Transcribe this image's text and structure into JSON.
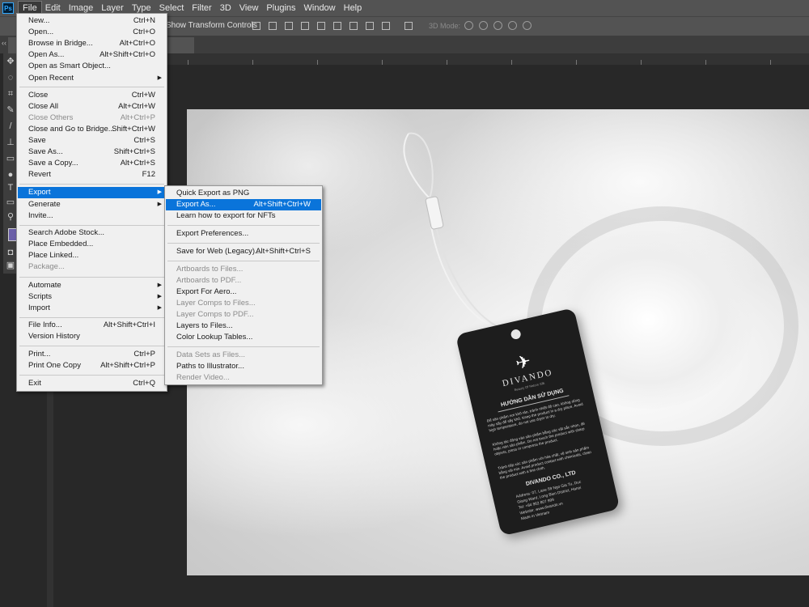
{
  "menubar": {
    "logo": "Ps",
    "items": [
      "File",
      "Edit",
      "Image",
      "Layer",
      "Type",
      "Select",
      "Filter",
      "3D",
      "View",
      "Plugins",
      "Window",
      "Help"
    ]
  },
  "options_bar": {
    "transform_label": "Show Transform Controls",
    "mode_3d": "3D Mode:"
  },
  "toolbar": {
    "collapse": "‹‹"
  },
  "file_menu": {
    "items": [
      {
        "label": "New...",
        "shortcut": "Ctrl+N"
      },
      {
        "label": "Open...",
        "shortcut": "Ctrl+O"
      },
      {
        "label": "Browse in Bridge...",
        "shortcut": "Alt+Ctrl+O"
      },
      {
        "label": "Open As...",
        "shortcut": "Alt+Shift+Ctrl+O"
      },
      {
        "label": "Open as Smart Object..."
      },
      {
        "label": "Open Recent",
        "submenu": true
      },
      {
        "label": "Close",
        "shortcut": "Ctrl+W"
      },
      {
        "label": "Close All",
        "shortcut": "Alt+Ctrl+W"
      },
      {
        "label": "Close Others",
        "shortcut": "Alt+Ctrl+P",
        "disabled": true
      },
      {
        "label": "Close and Go to Bridge...",
        "shortcut": "Shift+Ctrl+W"
      },
      {
        "label": "Save",
        "shortcut": "Ctrl+S"
      },
      {
        "label": "Save As...",
        "shortcut": "Shift+Ctrl+S"
      },
      {
        "label": "Save a Copy...",
        "shortcut": "Alt+Ctrl+S"
      },
      {
        "label": "Revert",
        "shortcut": "F12"
      },
      {
        "label": "Export",
        "submenu": true,
        "highlighted": true
      },
      {
        "label": "Generate",
        "submenu": true
      },
      {
        "label": "Invite..."
      },
      {
        "label": "Search Adobe Stock..."
      },
      {
        "label": "Place Embedded..."
      },
      {
        "label": "Place Linked..."
      },
      {
        "label": "Package...",
        "disabled": true
      },
      {
        "label": "Automate",
        "submenu": true
      },
      {
        "label": "Scripts",
        "submenu": true
      },
      {
        "label": "Import",
        "submenu": true
      },
      {
        "label": "File Info...",
        "shortcut": "Alt+Shift+Ctrl+I"
      },
      {
        "label": "Version History"
      },
      {
        "label": "Print...",
        "shortcut": "Ctrl+P"
      },
      {
        "label": "Print One Copy",
        "shortcut": "Alt+Shift+Ctrl+P"
      },
      {
        "label": "Exit",
        "shortcut": "Ctrl+Q"
      }
    ]
  },
  "export_menu": {
    "items": [
      {
        "label": "Quick Export as PNG"
      },
      {
        "label": "Export As...",
        "shortcut": "Alt+Shift+Ctrl+W",
        "highlighted": true
      },
      {
        "label": "Learn how to export for NFTs"
      },
      {
        "label": "Export Preferences..."
      },
      {
        "label": "Save for Web (Legacy)...",
        "shortcut": "Alt+Shift+Ctrl+S"
      },
      {
        "label": "Artboards to Files...",
        "disabled": true
      },
      {
        "label": "Artboards to PDF...",
        "disabled": true
      },
      {
        "label": "Export For Aero..."
      },
      {
        "label": "Layer Comps to Files...",
        "disabled": true
      },
      {
        "label": "Layer Comps to PDF...",
        "disabled": true
      },
      {
        "label": "Layers to Files..."
      },
      {
        "label": "Color Lookup Tables..."
      },
      {
        "label": "Data Sets as Files...",
        "disabled": true
      },
      {
        "label": "Paths to Illustrator..."
      },
      {
        "label": "Render Video...",
        "disabled": true
      }
    ]
  },
  "tag": {
    "brand": "DIVANDO",
    "slogan": "Beauty Of Nature Silk",
    "heading": "HƯỚNG DẪN SỬ DỤNG",
    "para1": "Để sản phẩm nơi khô ráo, tránh nhiệt độ cao, không dùng máy sấy để sấy khô. Keep the product in a dry place. Avoid high temperature, do not use dryer to dry.",
    "para2": "Không tác động vào sản phẩm bằng các vật sắc nhọn, đè hoặc nén sản phẩm. Do not touch the product with sharp objects, press or compress the product.",
    "para3": "Tránh tiếp xúc sản phẩm với hóa chất, vệ sinh sản phẩm bằng vải mịn. Avoid product contact with chemicals, clean the product with a fine cloth.",
    "company": "DIVANDO CO., LTD",
    "address1": "Address: 07, Lane 59 Ngo Gia Tu, Duc",
    "address2": "Giang Ward, Long Bien District, Hanoi",
    "phone": "Tel: +84 962 807 999",
    "website": "Website: www.divando.vn",
    "made_in": "Made in Vietnam"
  }
}
